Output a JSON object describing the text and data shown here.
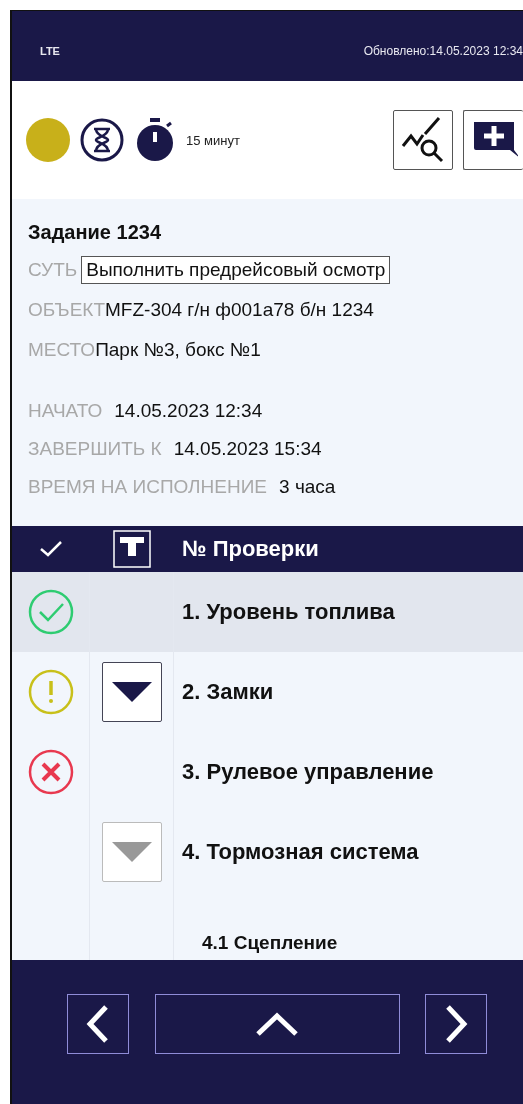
{
  "status_bar": {
    "network": "LTE",
    "updated": "Обновлено:14.05.2023 12:34"
  },
  "toolbar": {
    "color": "#c8b01a",
    "timer": "15 минут"
  },
  "task": {
    "title": "Задание 1234",
    "fields": [
      {
        "label": "СУТЬ",
        "value": "Выполнить предрейсовый осмотр",
        "kind": "boxed"
      },
      {
        "label": "ОБЪЕКТ",
        "value": "MFZ-304 г/н ф001а78 б/н 1234",
        "kind": "plain"
      },
      {
        "label": "МЕСТО",
        "value": "Парк №3, бокс №1",
        "kind": "plain"
      }
    ],
    "times": [
      {
        "label": "НАЧАТО",
        "value": "14.05.2023 12:34"
      },
      {
        "label": "ЗАВЕРШИТЬ К",
        "value": "14.05.2023 15:34"
      },
      {
        "label": "ВРЕМЯ НА ИСПОЛНЕНИЕ",
        "value": "3 часа"
      }
    ]
  },
  "checks": {
    "column_title": "№ Проверки",
    "rows": [
      {
        "title": "1. Уровень топлива",
        "kind": "passed",
        "has_toggle": false,
        "selected": true
      },
      {
        "title": "2. Замки",
        "kind": "warning",
        "has_toggle": true,
        "disabled": false,
        "selected": false
      },
      {
        "title": "3. Рулевое управление",
        "kind": "failed",
        "has_toggle": false,
        "selected": false
      },
      {
        "title": "4. Тормозная система",
        "has_toggle": true,
        "disabled": true,
        "selected": false,
        "children": [
          {
            "title": "4.1 Сцепление",
            "has_toggle": false,
            "selected": false
          }
        ]
      }
    ]
  }
}
